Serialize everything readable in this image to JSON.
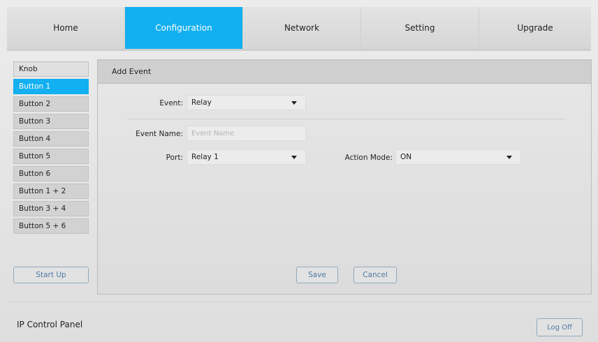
{
  "nav": {
    "items": [
      {
        "label": "Home"
      },
      {
        "label": "Configuration"
      },
      {
        "label": "Network"
      },
      {
        "label": "Setting"
      },
      {
        "label": "Upgrade"
      }
    ],
    "active_color": "#12b0f0"
  },
  "sidebar": {
    "items": [
      {
        "label": "Knob"
      },
      {
        "label": "Button 1"
      },
      {
        "label": "Button 2"
      },
      {
        "label": "Button 3"
      },
      {
        "label": "Button 4"
      },
      {
        "label": "Button 5"
      },
      {
        "label": "Button 6"
      },
      {
        "label": "Button 1 + 2"
      },
      {
        "label": "Button 3 + 4"
      },
      {
        "label": "Button 5 + 6"
      }
    ],
    "startup_label": "Start Up"
  },
  "panel": {
    "header": "Add Event",
    "event_label": "Event:",
    "event_value": "Relay",
    "event_name_label": "Event Name:",
    "event_name_placeholder": "Event Name",
    "event_name_value": "",
    "port_label": "Port:",
    "port_value": "Relay 1",
    "action_mode_label": "Action Mode:",
    "action_mode_value": "ON",
    "save_label": "Save",
    "cancel_label": "Cancel"
  },
  "footer": {
    "title": "IP Control Panel",
    "logoff_label": "Log Off"
  }
}
